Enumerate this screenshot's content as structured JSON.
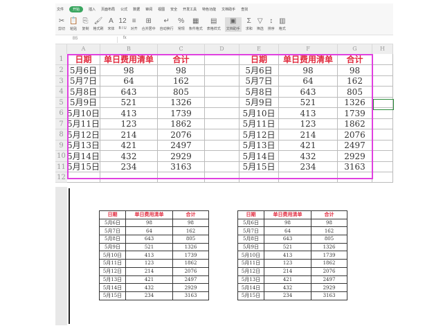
{
  "ribbon": {
    "tabs": [
      "文件",
      "开始",
      "插入",
      "页面布局",
      "公式",
      "数据",
      "审阅",
      "视图",
      "安全",
      "开发工具",
      "特色功能",
      "文档助手",
      "查找"
    ],
    "active_tab": "开始",
    "tools": [
      {
        "icon": "✂",
        "label": "剪切"
      },
      {
        "icon": "📋",
        "label": "粘贴"
      },
      {
        "icon": "⎘",
        "label": "复制"
      },
      {
        "icon": "🖌",
        "label": "格式刷"
      },
      {
        "icon": "A",
        "label": "宋体"
      },
      {
        "icon": "12",
        "label": "B I U"
      },
      {
        "icon": "≡",
        "label": "对齐"
      },
      {
        "icon": "⊞",
        "label": "合并居中"
      },
      {
        "icon": "↵",
        "label": "自动换行"
      },
      {
        "icon": "%",
        "label": "常规"
      },
      {
        "icon": "▦",
        "label": "条件格式"
      },
      {
        "icon": "▤",
        "label": "表格样式"
      },
      {
        "icon": "▣",
        "label": "文档助手"
      },
      {
        "icon": "Σ",
        "label": "求和"
      },
      {
        "icon": "▽",
        "label": "筛选"
      },
      {
        "icon": "↕",
        "label": "排序"
      },
      {
        "icon": "▥",
        "label": "格式"
      }
    ]
  },
  "formula_bar": {
    "name_box": "B5",
    "fx": "fx",
    "value": ""
  },
  "sheet": {
    "columns": [
      "A",
      "B",
      "C",
      "D",
      "E",
      "F",
      "G",
      "H"
    ],
    "rows": [
      "1",
      "2",
      "3",
      "4",
      "5",
      "6",
      "7",
      "8",
      "9",
      "10",
      "11",
      "12"
    ],
    "headers": [
      "日期",
      "单日费用清单",
      "合计"
    ],
    "data": [
      [
        "5月6日",
        "98",
        "98"
      ],
      [
        "5月7日",
        "64",
        "162"
      ],
      [
        "5月8日",
        "643",
        "805"
      ],
      [
        "5月9日",
        "521",
        "1326"
      ],
      [
        "5月10日",
        "413",
        "1739"
      ],
      [
        "5月11日",
        "123",
        "1862"
      ],
      [
        "5月12日",
        "214",
        "2076"
      ],
      [
        "5月13日",
        "421",
        "2497"
      ],
      [
        "5月14日",
        "432",
        "2929"
      ],
      [
        "5月15日",
        "234",
        "3163"
      ]
    ]
  },
  "colors": {
    "header_red": "#e0283c",
    "selection_pink": "#e040e0",
    "accent_green": "#3aa660"
  }
}
